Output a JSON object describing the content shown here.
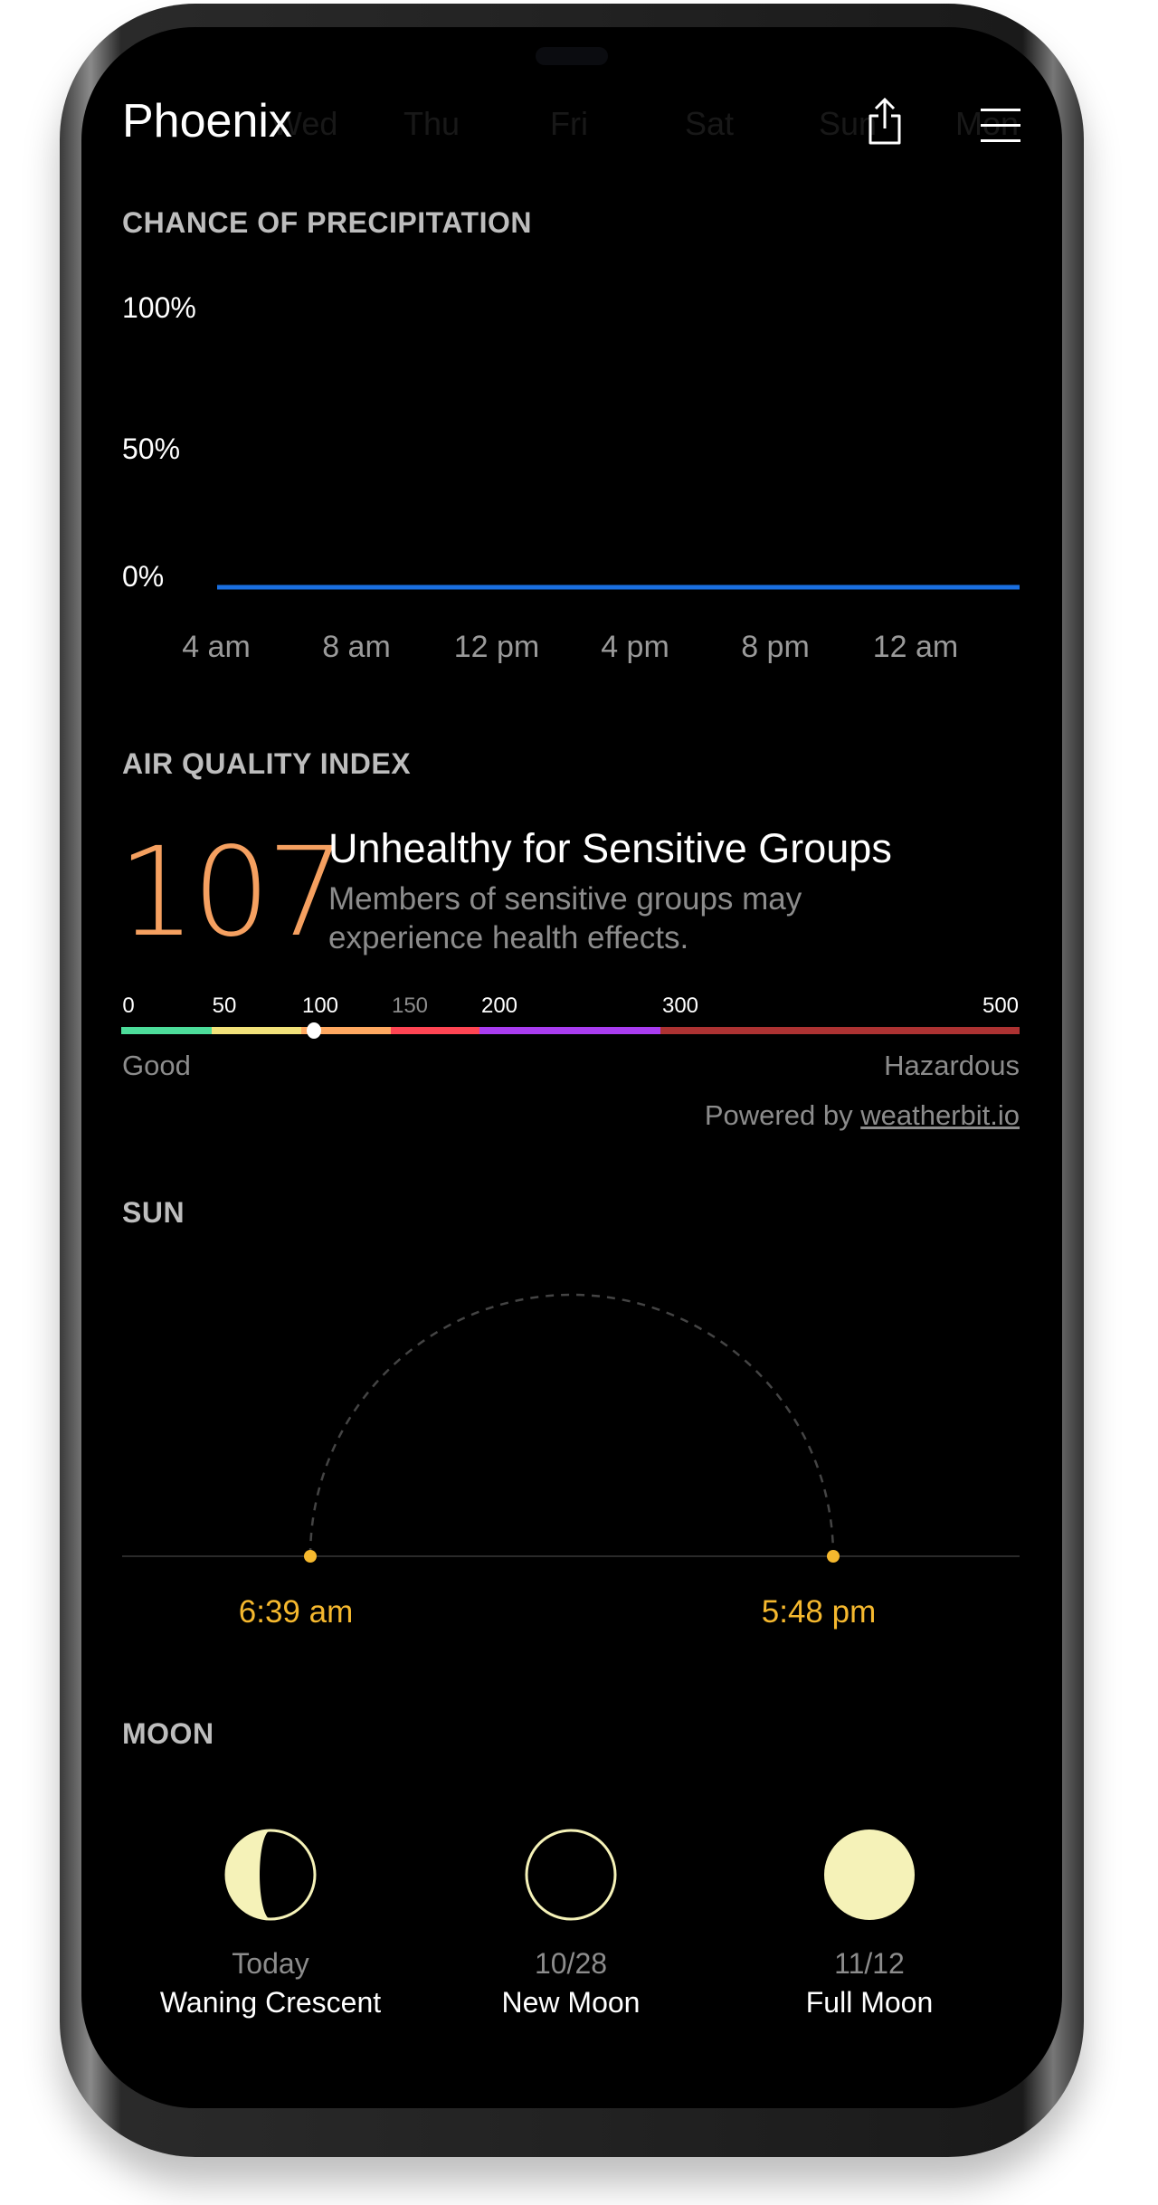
{
  "header": {
    "city": "Phoenix",
    "days": [
      "Wed",
      "Thu",
      "Fri",
      "Sat",
      "Sun",
      "Mon"
    ],
    "share_icon": "share-icon",
    "menu_icon": "menu-icon"
  },
  "precipitation": {
    "heading": "CHANCE OF PRECIPITATION",
    "chart_data": {
      "type": "line",
      "y_tick_labels": [
        "100%",
        "50%",
        "0%"
      ],
      "ylim": [
        0,
        100
      ],
      "x_tick_labels": [
        "4 am",
        "8 am",
        "12 pm",
        "4 pm",
        "8 pm",
        "12 am"
      ],
      "values": [
        0,
        0,
        0,
        0,
        0,
        0
      ],
      "color": "#1a6fe0"
    }
  },
  "aqi": {
    "heading": "AIR QUALITY INDEX",
    "value": "107",
    "category": "Unhealthy for Sensitive Groups",
    "description_line1": "Members of sensitive groups may",
    "description_line2": "experience health effects.",
    "scale_labels": [
      "0",
      "50",
      "100",
      "150",
      "200",
      "300",
      "500"
    ],
    "scale_colors": [
      "#4cdd9a",
      "#f2e27a",
      "#ffa860",
      "#ff4553",
      "#a93cf0",
      "#ad3232"
    ],
    "low_label": "Good",
    "high_label": "Hazardous",
    "powered_by": "Powered by",
    "provider": "weatherbit.io",
    "value_color": "#f5a060"
  },
  "sun": {
    "heading": "SUN",
    "sunrise": "6:39 am",
    "sunset": "5:48 pm",
    "color": "#f5b82e"
  },
  "moon": {
    "heading": "MOON",
    "phases": [
      {
        "date": "Today",
        "name": "Waning Crescent",
        "icon": "waning-crescent-icon"
      },
      {
        "date": "10/28",
        "name": "New Moon",
        "icon": "new-moon-icon"
      },
      {
        "date": "11/12",
        "name": "Full Moon",
        "icon": "full-moon-icon"
      }
    ],
    "color": "#f5f2b8"
  }
}
